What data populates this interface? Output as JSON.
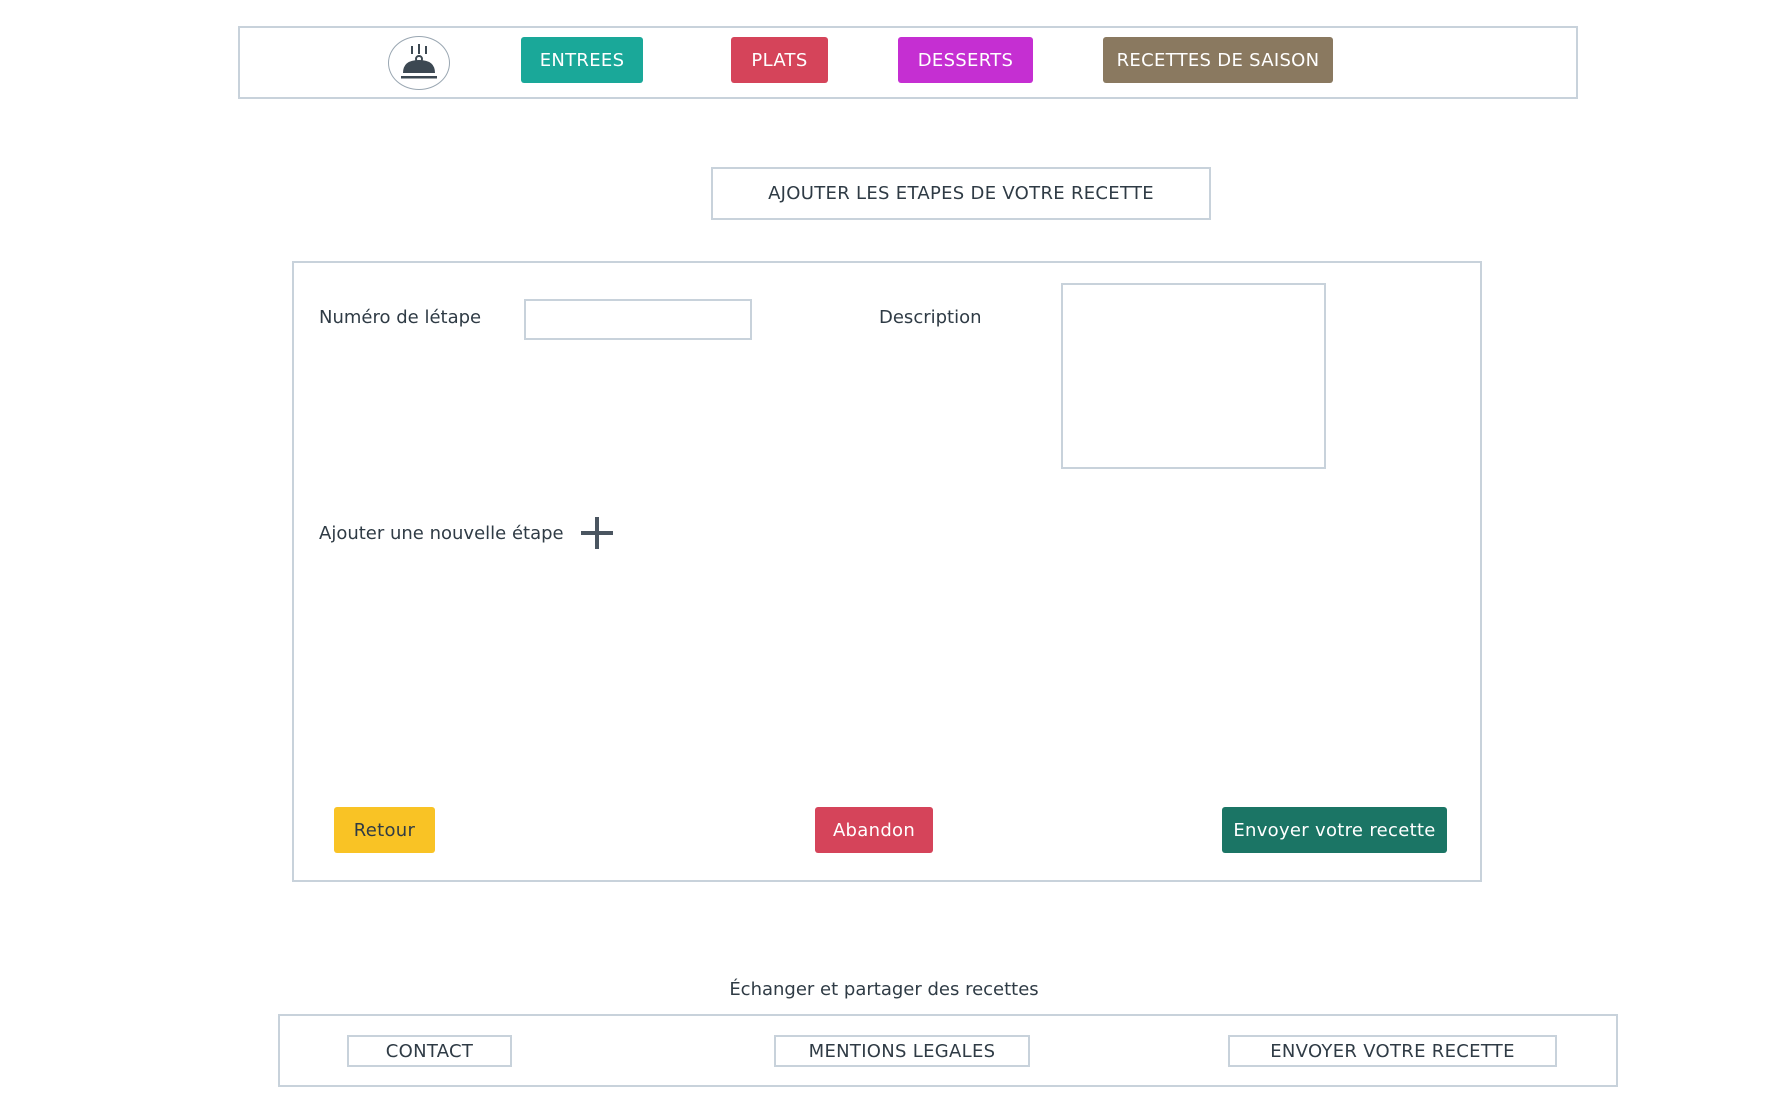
{
  "header": {
    "logo_icon": "serving-cloche-icon",
    "nav": [
      {
        "label": "ENTREES",
        "color": "#1aa899"
      },
      {
        "label": "PLATS",
        "color": "#d5445a"
      },
      {
        "label": "DESSERTS",
        "color": "#c52fd2"
      },
      {
        "label": "RECETTES DE SAISON",
        "color": "#8a7960"
      }
    ]
  },
  "main": {
    "title": "AJOUTER LES ETAPES DE VOTRE RECETTE",
    "form": {
      "step_number_label": "Numéro de létape",
      "step_number_value": "",
      "description_label": "Description",
      "description_value": "",
      "add_step_label": "Ajouter une nouvelle étape",
      "add_step_icon": "plus-icon"
    },
    "actions": {
      "back": {
        "label": "Retour",
        "color": "#f9c325"
      },
      "abandon": {
        "label": "Abandon",
        "color": "#d5445a"
      },
      "submit": {
        "label": "Envoyer votre recette",
        "color": "#1b7565"
      }
    }
  },
  "footer": {
    "tagline": "Échanger et partager des recettes",
    "links": [
      {
        "label": "CONTACT"
      },
      {
        "label": "MENTIONS LEGALES"
      },
      {
        "label": "ENVOYER VOTRE RECETTE"
      }
    ]
  }
}
